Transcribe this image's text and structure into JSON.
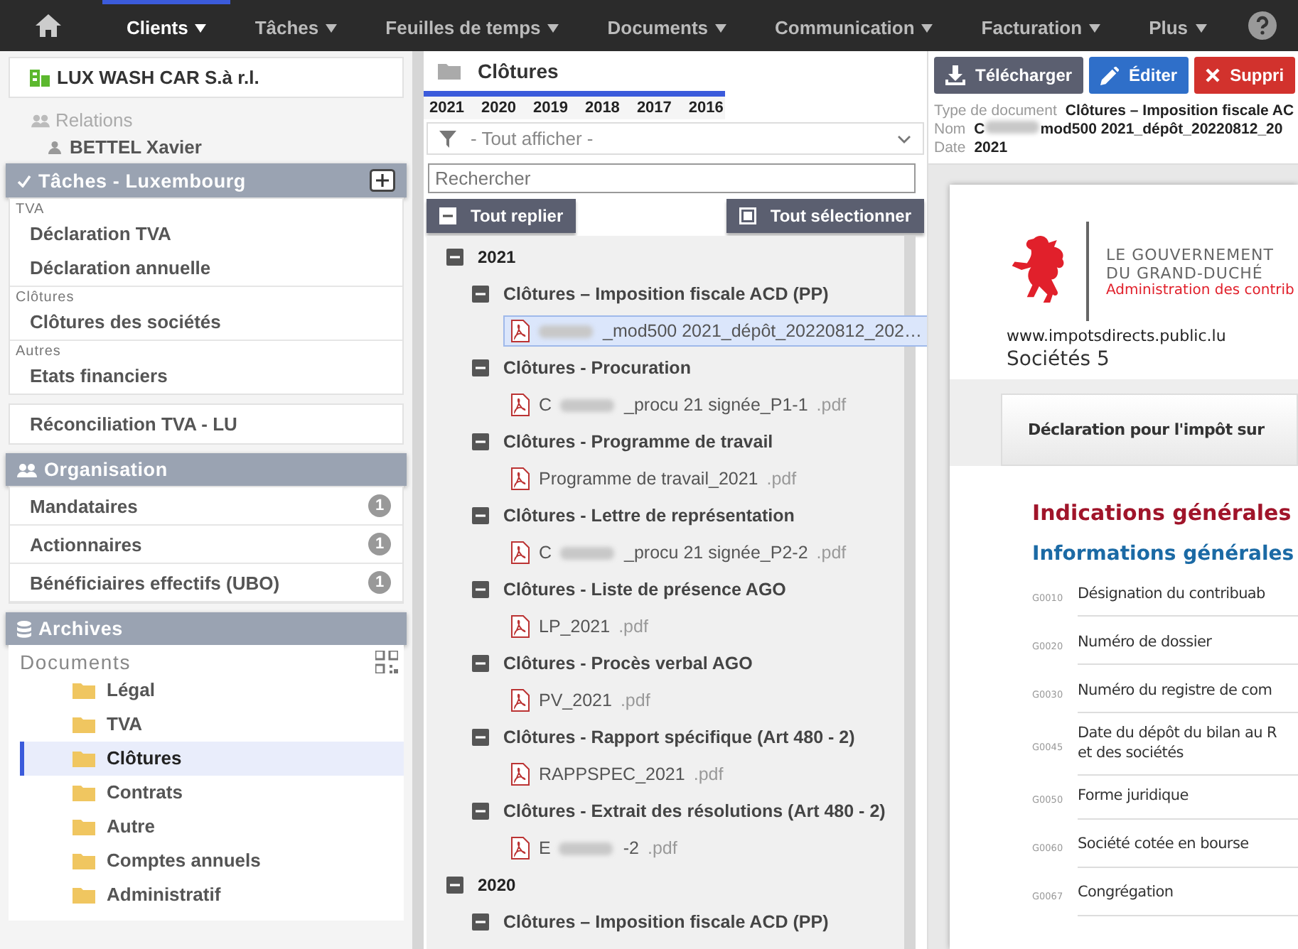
{
  "nav": {
    "items": [
      {
        "label": "Clients",
        "selected": true
      },
      {
        "label": "Tâches",
        "selected": false
      },
      {
        "label": "Feuilles de temps",
        "selected": false
      },
      {
        "label": "Documents",
        "selected": false
      },
      {
        "label": "Communication",
        "selected": false
      },
      {
        "label": "Facturation",
        "selected": false
      },
      {
        "label": "Plus",
        "selected": false
      }
    ]
  },
  "client": {
    "name": "LUX WASH CAR S.à r.l.",
    "relations_label": "Relations",
    "relations": [
      "BETTEL Xavier"
    ]
  },
  "tasks": {
    "title": "Tâches - Luxembourg",
    "checked": true,
    "groups": [
      {
        "label": "TVA",
        "items": [
          "Déclaration TVA",
          "Déclaration annuelle"
        ]
      },
      {
        "label": "Clôtures",
        "items": [
          "Clôtures des sociétés"
        ]
      },
      {
        "label": "Autres",
        "items": [
          "Etats financiers"
        ]
      }
    ]
  },
  "standalone_task": "Réconciliation TVA - LU",
  "organisation": {
    "title": "Organisation",
    "items": [
      {
        "label": "Mandataires",
        "count": "1"
      },
      {
        "label": "Actionnaires",
        "count": "1"
      },
      {
        "label": "Bénéficiaires effectifs (UBO)",
        "count": "1"
      }
    ]
  },
  "archives": {
    "title": "Archives",
    "root": "Documents",
    "folders": [
      {
        "label": "Légal",
        "selected": false
      },
      {
        "label": "TVA",
        "selected": false
      },
      {
        "label": "Clôtures",
        "selected": true
      },
      {
        "label": "Contrats",
        "selected": false
      },
      {
        "label": "Autre",
        "selected": false
      },
      {
        "label": "Comptes annuels",
        "selected": false
      },
      {
        "label": "Administratif",
        "selected": false
      }
    ]
  },
  "folder": {
    "title": "Clôtures",
    "years": [
      "2021",
      "2020",
      "2019",
      "2018",
      "2017",
      "2016"
    ],
    "filter": "- Tout afficher -",
    "search_placeholder": "Rechercher",
    "collapse_all": "Tout replier",
    "select_all": "Tout sélectionner"
  },
  "tree": [
    {
      "kind": "year",
      "label": "2021",
      "expanded": true,
      "children": [
        {
          "kind": "category",
          "label": "Clôtures – Imposition fiscale ACD (PP)",
          "expanded": true,
          "children": [
            {
              "kind": "file",
              "redacted": true,
              "name": "_mod500 2021_dépôt_20220812_202…",
              "selected": true
            }
          ]
        },
        {
          "kind": "category",
          "label": "Clôtures - Procuration",
          "expanded": true,
          "children": [
            {
              "kind": "file",
              "prefix": "C",
              "redacted": true,
              "name": "_procu 21 signée_P1-1",
              "ext": ".pdf",
              "selected": false
            }
          ]
        },
        {
          "kind": "category",
          "label": "Clôtures - Programme de travail",
          "expanded": true,
          "children": [
            {
              "kind": "file",
              "name": "Programme de travail_2021",
              "ext": ".pdf",
              "selected": false
            }
          ]
        },
        {
          "kind": "category",
          "label": "Clôtures - Lettre de représentation",
          "expanded": true,
          "children": [
            {
              "kind": "file",
              "prefix": "C",
              "redacted": true,
              "name": "_procu 21 signée_P2-2",
              "ext": ".pdf",
              "selected": false
            }
          ]
        },
        {
          "kind": "category",
          "label": "Clôtures - Liste de présence AGO",
          "expanded": true,
          "children": [
            {
              "kind": "file",
              "name": "LP_2021",
              "ext": ".pdf",
              "selected": false
            }
          ]
        },
        {
          "kind": "category",
          "label": "Clôtures - Procès verbal AGO",
          "expanded": true,
          "children": [
            {
              "kind": "file",
              "name": "PV_2021",
              "ext": ".pdf",
              "selected": false
            }
          ]
        },
        {
          "kind": "category",
          "label": "Clôtures - Rapport spécifique (Art 480 - 2)",
          "expanded": true,
          "children": [
            {
              "kind": "file",
              "name": "RAPPSPEC_2021",
              "ext": ".pdf",
              "selected": false
            }
          ]
        },
        {
          "kind": "category",
          "label": "Clôtures - Extrait des résolutions (Art 480 - 2)",
          "expanded": true,
          "children": [
            {
              "kind": "file",
              "prefix": "E",
              "redacted": true,
              "name": "-2",
              "ext": ".pdf",
              "selected": false
            }
          ]
        }
      ]
    },
    {
      "kind": "year",
      "label": "2020",
      "expanded": true,
      "children": [
        {
          "kind": "category",
          "label": "Clôtures – Imposition fiscale ACD (PP)",
          "expanded": true
        }
      ]
    }
  ],
  "actions": [
    {
      "kind": "download",
      "label": "Télécharger"
    },
    {
      "kind": "edit",
      "label": "Éditer"
    },
    {
      "kind": "delete",
      "label": "Suppri"
    }
  ],
  "meta": [
    {
      "label": "Type de document",
      "value": "Clôtures – Imposition fiscale AC"
    },
    {
      "label": "Nom",
      "prefix": "C",
      "redacted": true,
      "value": "mod500 2021_dépôt_20220812_20"
    },
    {
      "label": "Date",
      "value": "2021"
    }
  ],
  "preview": {
    "gov_lines": [
      "LE GOUVERNEMENT",
      "DU GRAND-DUCHÉ"
    ],
    "administration": "Administration des contrib",
    "website": "www.impotsdirects.public.lu",
    "form": "Sociétés 5",
    "heading": "Déclaration pour l'impôt sur",
    "section": "Indications générales",
    "subsection": "Informations générales",
    "rows": [
      {
        "code": "G0010",
        "lines": [
          "Désignation du contribuab"
        ]
      },
      {
        "code": "G0020",
        "lines": [
          "Numéro de dossier"
        ]
      },
      {
        "code": "G0030",
        "lines": [
          "Numéro du registre de com"
        ]
      },
      {
        "code": "G0045",
        "lines": [
          "Date du dépôt du bilan au R",
          "et des sociétés"
        ]
      },
      {
        "code": "G0050",
        "lines": [
          "Forme juridique"
        ]
      },
      {
        "code": "G0060",
        "lines": [
          "Société cotée en bourse"
        ]
      },
      {
        "code": "G0067",
        "lines": [
          "Congrégation"
        ]
      }
    ]
  }
}
